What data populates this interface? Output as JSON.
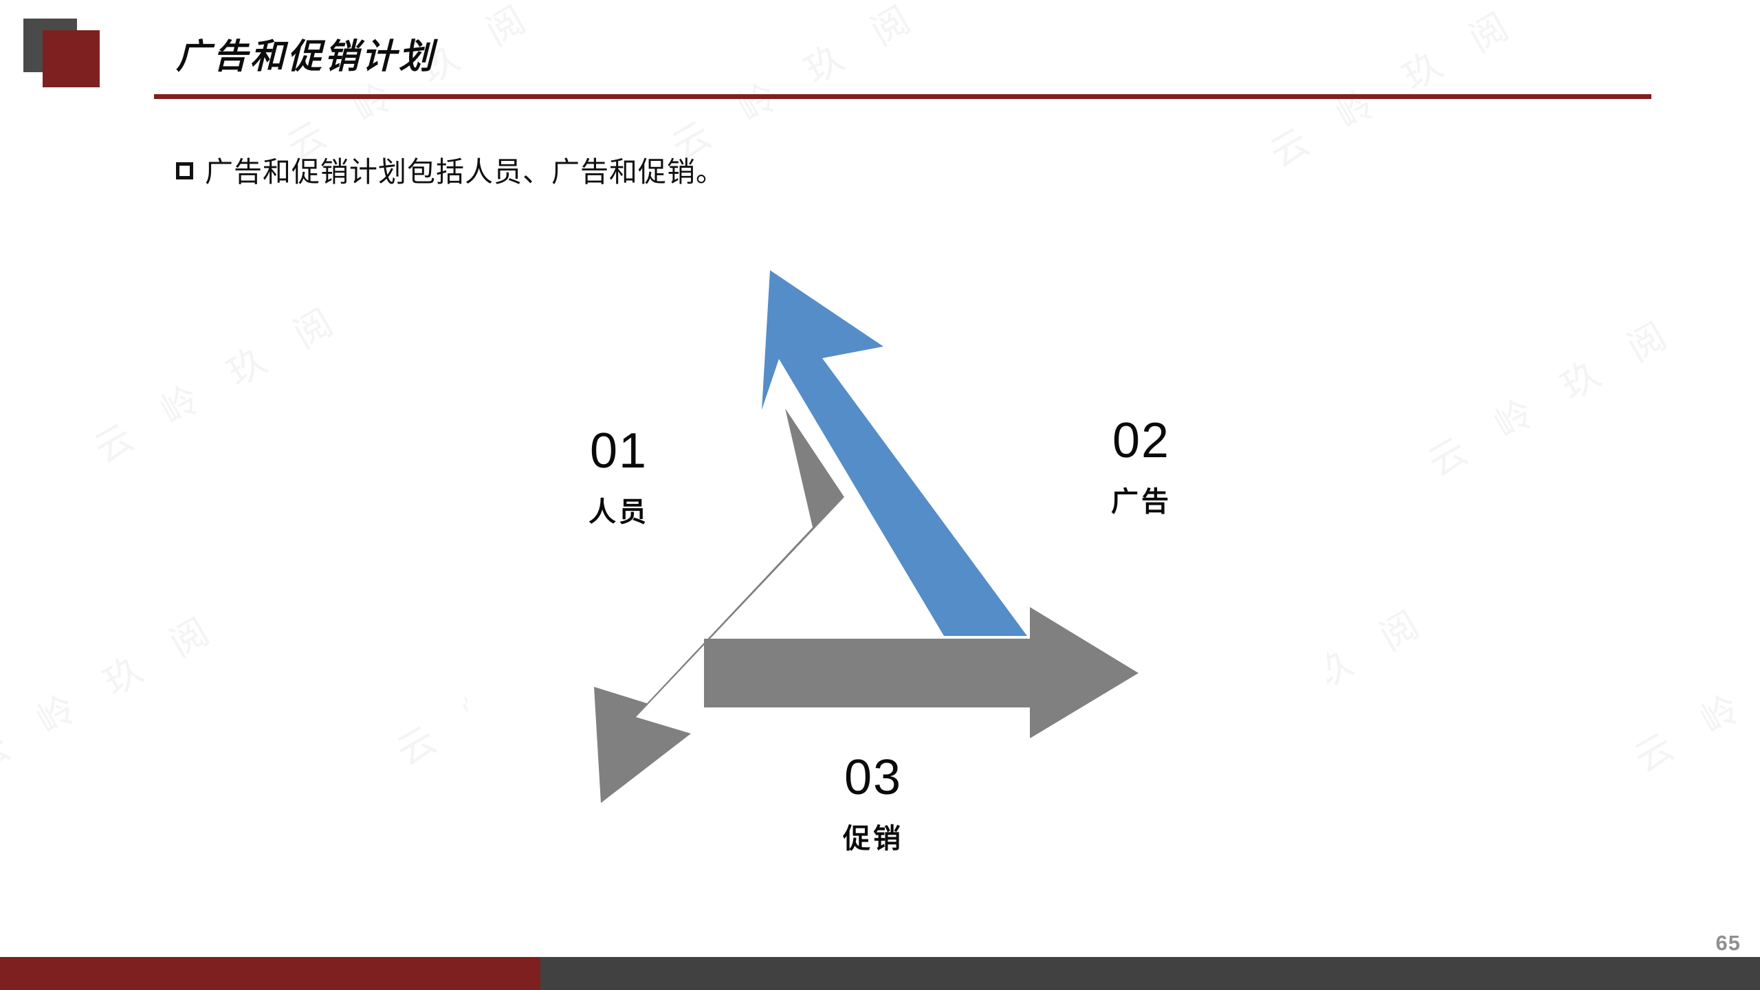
{
  "slide": {
    "title": "广告和促销计划",
    "page_number": "65",
    "watermark_text": "云 岭 玖 阅"
  },
  "header": {
    "decoration": {
      "square_gray_color": "#4a4a4a",
      "square_red_color": "#7d201f"
    },
    "rule_color": "#7d201f"
  },
  "body": {
    "bullet_marker": "hollow-square",
    "bullet_text": "广告和促销计划包括人员、广告和促销。"
  },
  "diagram": {
    "type": "triangular-cycle-arrows",
    "colors": {
      "gray_arrow": "#808080",
      "blue_arrow": "#548dc8",
      "background": "#ffffff"
    },
    "steps": [
      {
        "number": "01",
        "name": "人员",
        "arrow": "down-left",
        "arrow_color": "#808080"
      },
      {
        "number": "02",
        "name": "广告",
        "arrow": "up-left",
        "arrow_color": "#548dc8"
      },
      {
        "number": "03",
        "name": "促销",
        "arrow": "right",
        "arrow_color": "#808080"
      }
    ]
  },
  "footer": {
    "bar_red_color": "#7d201f",
    "bar_gray_color": "#414141"
  }
}
